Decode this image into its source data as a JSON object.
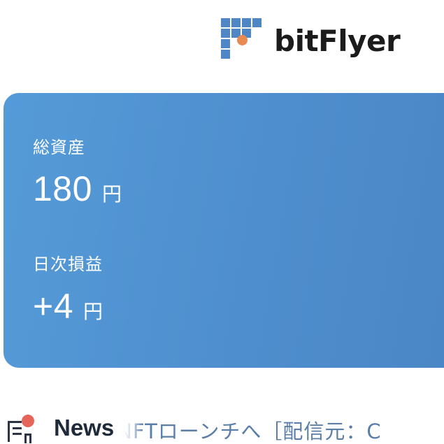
{
  "header": {
    "brand_name": "bitFlyer",
    "logo_icon": "bitflyer-logo-icon",
    "brand_colors": {
      "mark_blue": "#4f86c6",
      "mark_orange": "#e98a53"
    }
  },
  "asset_card": {
    "total_assets_label": "総資産",
    "total_assets_value": "180",
    "total_assets_unit": "円",
    "daily_pl_label": "日次損益",
    "daily_pl_value": "+4",
    "daily_pl_unit": "円",
    "gradient_colors": [
      "#559bd8",
      "#4a86c5"
    ]
  },
  "news": {
    "icon": "news-icon",
    "title": "News",
    "ticker_text": "NFTローンチへ［配信元：C"
  }
}
